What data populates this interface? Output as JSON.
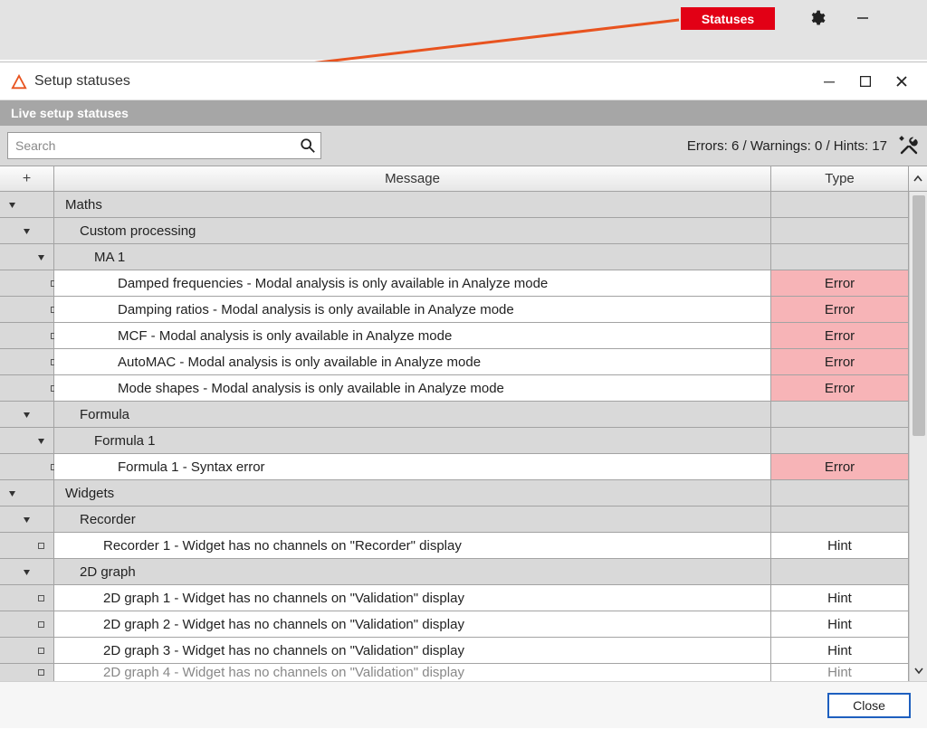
{
  "outer": {
    "statuses_btn": "Statuses"
  },
  "dialog": {
    "title": "Setup statuses",
    "banner": "Live setup statuses",
    "search_placeholder": "Search",
    "errors": 6,
    "warnings": 0,
    "hints": 17,
    "counts_text": "Errors: 6 / Warnings: 0 / Hints: 17",
    "plus_label": "+",
    "col_message": "Message",
    "col_type": "Type",
    "close_label": "Close"
  },
  "rows": [
    {
      "kind": "group",
      "level": 0,
      "label": "Maths"
    },
    {
      "kind": "group",
      "level": 1,
      "label": "Custom processing"
    },
    {
      "kind": "group",
      "level": 2,
      "label": "MA 1"
    },
    {
      "kind": "leaf",
      "level": 3,
      "label": "Damped frequencies - Modal analysis is only available in Analyze mode",
      "type": "Error"
    },
    {
      "kind": "leaf",
      "level": 3,
      "label": "Damping ratios - Modal analysis is only available in Analyze mode",
      "type": "Error"
    },
    {
      "kind": "leaf",
      "level": 3,
      "label": "MCF - Modal analysis is only available in Analyze mode",
      "type": "Error"
    },
    {
      "kind": "leaf",
      "level": 3,
      "label": "AutoMAC - Modal analysis is only available in Analyze mode",
      "type": "Error"
    },
    {
      "kind": "leaf",
      "level": 3,
      "label": "Mode shapes - Modal analysis is only available in Analyze mode",
      "type": "Error"
    },
    {
      "kind": "group",
      "level": 1,
      "label": "Formula"
    },
    {
      "kind": "group",
      "level": 2,
      "label": "Formula 1"
    },
    {
      "kind": "leaf",
      "level": 3,
      "label": "Formula 1 - Syntax error",
      "type": "Error"
    },
    {
      "kind": "group",
      "level": 0,
      "label": "Widgets"
    },
    {
      "kind": "group",
      "level": 1,
      "label": "Recorder"
    },
    {
      "kind": "leaf",
      "level": 2,
      "label": "Recorder 1 - Widget has no channels on \"Recorder\" display",
      "type": "Hint"
    },
    {
      "kind": "group",
      "level": 1,
      "label": "2D graph"
    },
    {
      "kind": "leaf",
      "level": 2,
      "label": "2D graph 1 - Widget has no channels on \"Validation\" display",
      "type": "Hint"
    },
    {
      "kind": "leaf",
      "level": 2,
      "label": "2D graph 2 - Widget has no channels on \"Validation\" display",
      "type": "Hint"
    },
    {
      "kind": "leaf",
      "level": 2,
      "label": "2D graph 3 - Widget has no channels on \"Validation\" display",
      "type": "Hint"
    },
    {
      "kind": "leaf",
      "level": 2,
      "label": "2D graph 4 - Widget has no channels on \"Validation\" display",
      "type": "Hint",
      "cutoff": true
    }
  ]
}
